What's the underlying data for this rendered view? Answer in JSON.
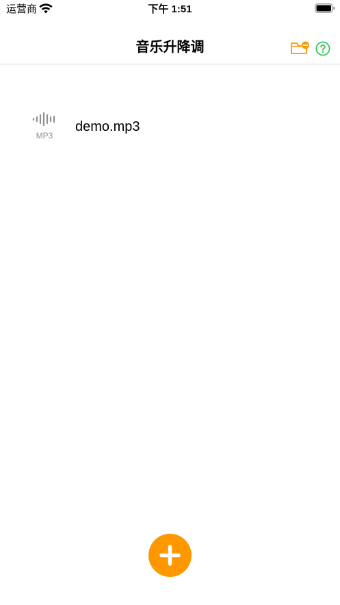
{
  "status_bar": {
    "carrier": "运营商",
    "time": "下午 1:51"
  },
  "nav": {
    "title": "音乐升降调",
    "folder_icon": "folder-minus-icon",
    "help_icon": "question-circle-icon"
  },
  "files": [
    {
      "name": "demo.mp3",
      "format": "MP3",
      "icon": "waveform-icon"
    }
  ],
  "fab": {
    "icon": "plus-icon"
  },
  "colors": {
    "accent": "#ff9800",
    "help": "#34c759",
    "secondary_text": "#8e8e93"
  }
}
